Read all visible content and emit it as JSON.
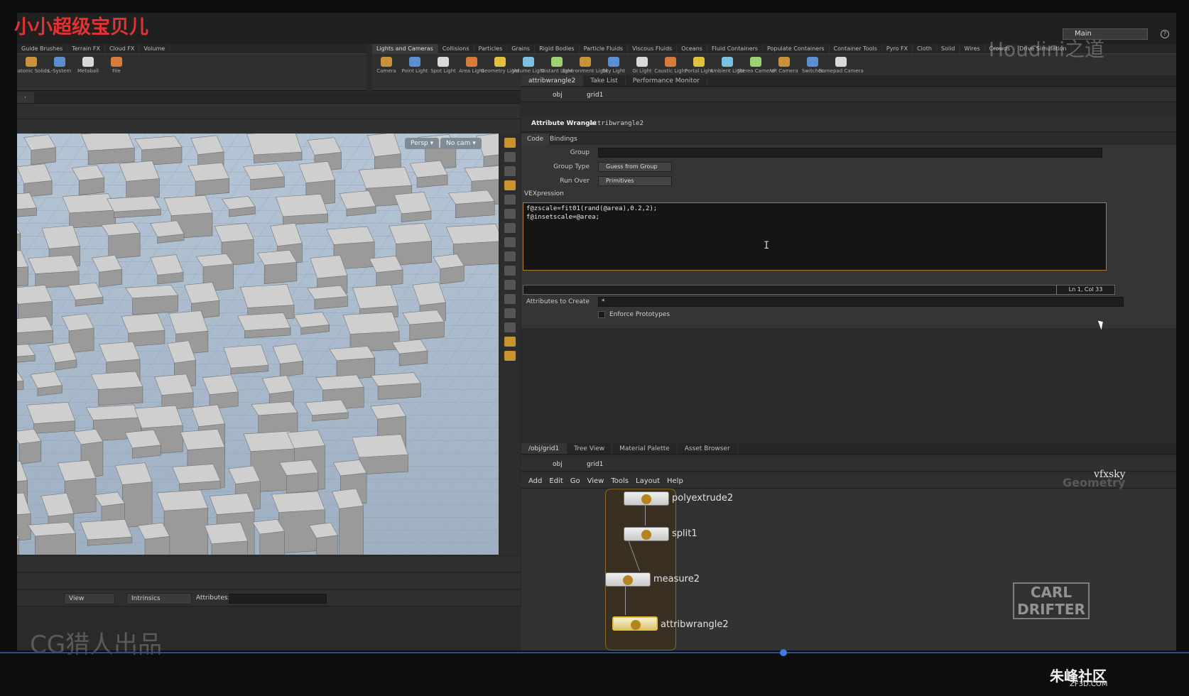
{
  "watermarks": {
    "top_left": "小小超级宝贝儿",
    "houdini": "Houdini之道",
    "bottom_left": "CG猎人出品",
    "carl": "CARL DRIFTER",
    "site_main": "朱峰社区",
    "site_sub": "ZF3D.COM",
    "vfxsky": "vfxsky",
    "context": "Geometry"
  },
  "desktop": {
    "label": "Main"
  },
  "shelf_left": {
    "tabs": [
      "Guide Brushes",
      "Terrain FX",
      "Cloud FX",
      "Volume"
    ],
    "tools": [
      "Platonic Solids",
      "L-System",
      "Metaball",
      "File"
    ]
  },
  "shelf_right": {
    "tabs": [
      "Lights and Cameras",
      "Collisions",
      "Particles",
      "Grains",
      "Rigid Bodies",
      "Particle Fluids",
      "Viscous Fluids",
      "Oceans",
      "Fluid Containers",
      "Populate Containers",
      "Container Tools",
      "Pyro FX",
      "Cloth",
      "Solid",
      "Wires",
      "Crowds",
      "Drive Simulation"
    ],
    "tools": [
      "Camera",
      "Point Light",
      "Spot Light",
      "Area Light",
      "Geometry Light",
      "Volume Light",
      "Distant Light",
      "Environment Light",
      "Sky Light",
      "GI Light",
      "Caustic Light",
      "Portal Light",
      "Ambient Light",
      "Stereo Camera",
      "VR Camera",
      "Switcher",
      "Gamepad Camera"
    ]
  },
  "viewport": {
    "persp": "Persp ▾",
    "cam": "No cam ▾"
  },
  "lower_left": {
    "view": "View",
    "intrinsics": "Intrinsics",
    "attributes": "Attributes:"
  },
  "param_tabs": [
    "attribwrangle2",
    "Take List",
    "Performance Monitor"
  ],
  "path": {
    "obj": "obj",
    "node": "grid1"
  },
  "node_header": {
    "type": "Attribute Wrangle",
    "name": "attribwrangle2"
  },
  "sub_tabs": [
    "Code",
    "Bindings"
  ],
  "params": {
    "group_label": "Group",
    "group_type_label": "Group Type",
    "group_type_value": "Guess from Group",
    "run_over_label": "Run Over",
    "run_over_value": "Primitives",
    "vex_label": "VEXpression",
    "code_lines": [
      "f@zscale=fit01(rand(@area),0.2,2);",
      "f@insetscale=@area;"
    ],
    "cursor_pos": "Ln 1, Col 33",
    "attr_create_label": "Attributes to Create",
    "attr_create_value": "*",
    "enforce_label": "Enforce Prototypes"
  },
  "net_tabs": [
    "/obj/grid1",
    "Tree View",
    "Material Palette",
    "Asset Browser"
  ],
  "net_menu": [
    "Add",
    "Edit",
    "Go",
    "View",
    "Tools",
    "Layout",
    "Help"
  ],
  "nodes": [
    "polyextrude2",
    "split1",
    "measure2",
    "attribwrangle2"
  ]
}
